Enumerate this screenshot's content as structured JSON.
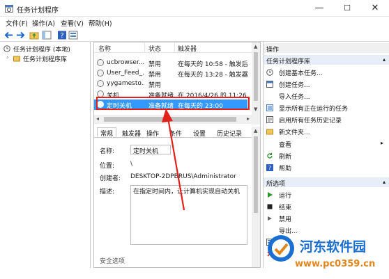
{
  "window": {
    "title": "任务计划程序"
  },
  "window_controls": {
    "minimize": "—",
    "maximize": "☐",
    "close": "✕"
  },
  "menu": [
    "文件(F)",
    "操作(A)",
    "查看(V)",
    "帮助(H)"
  ],
  "toolbar": {
    "buttons": [
      "back-icon",
      "forward-icon",
      "folder-up-icon",
      "console-icon",
      "help-icon",
      "properties-icon"
    ]
  },
  "tree": {
    "root": "任务计划程序 (本地)",
    "child": "任务计划程序库"
  },
  "task_list": {
    "columns": [
      "名称",
      "状态",
      "触发器"
    ],
    "rows": [
      {
        "name": "ucbrowser...",
        "status": "禁用",
        "trigger": "在每天的 10:58 - 触发后, 无"
      },
      {
        "name": "User_Feed_...",
        "status": "禁用",
        "trigger": "在每天的 13:28 - 触发器在"
      },
      {
        "name": "yygamesto...",
        "status": "禁用",
        "trigger": ""
      },
      {
        "name": "关机",
        "status": "准备就绪",
        "trigger": "在 2016/4/26 的 11:26 时"
      },
      {
        "name": "定时关机",
        "status": "准备就绪",
        "trigger": "在每天的 23:00"
      }
    ],
    "selected_index": 4
  },
  "detail_tabs": [
    "常规",
    "触发器",
    "操作",
    "条件",
    "设置",
    "历史记录"
  ],
  "detail": {
    "name_label": "名称:",
    "name_value": "定时关机",
    "location_label": "位置:",
    "location_value": "\\",
    "author_label": "创建者:",
    "author_value": "DESKTOP-2DPBRUS\\Administrator",
    "desc_label": "描述:",
    "desc_value": "在指定时间内，让计算机实现自动关机",
    "security_label": "安全选项"
  },
  "actions": {
    "header": "操作",
    "group1_title": "任务计划程序库",
    "group1": [
      {
        "icon": "create-basic-task-icon",
        "label": "创建基本任务..."
      },
      {
        "icon": "create-task-icon",
        "label": "创建任务..."
      },
      {
        "icon": "",
        "label": "导入任务..."
      },
      {
        "icon": "running-tasks-icon",
        "label": "显示所有正在运行的任务"
      },
      {
        "icon": "history-icon",
        "label": "启用所有任务历史记录"
      },
      {
        "icon": "new-folder-icon",
        "label": "新文件夹..."
      },
      {
        "icon": "",
        "label": "查看"
      },
      {
        "icon": "refresh-icon",
        "label": "刷新"
      },
      {
        "icon": "help-icon",
        "label": "帮助"
      }
    ],
    "group2_title": "所选项",
    "group2": [
      {
        "icon": "run-icon",
        "label": "运行"
      },
      {
        "icon": "end-icon",
        "label": "结束"
      },
      {
        "icon": "disable-icon",
        "label": "禁用"
      },
      {
        "icon": "",
        "label": "导出..."
      },
      {
        "icon": "properties-icon",
        "label": "属性"
      },
      {
        "icon": "delete-icon",
        "label": "删除"
      }
    ]
  },
  "watermark": {
    "name": "河东软件园",
    "url": "www.pc0359.cn"
  },
  "colors": {
    "selection": "#3399ff",
    "highlight_border": "#e3211b",
    "action_header": "#e8eef7",
    "watermark_blue": "#1a6fd0",
    "watermark_orange": "#e1861c"
  }
}
